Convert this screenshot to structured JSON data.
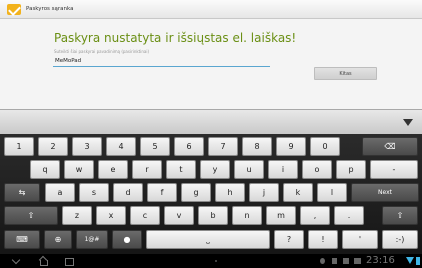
{
  "app": {
    "title": "Paskyros sąranka"
  },
  "main": {
    "headline": "Paskyra nustatyta ir išsiųstas el. laiškas!",
    "field_label": "Suteikti šiai paskyrai pavadinimą (pasirinktinai)",
    "name_value": "MeMoPad",
    "next_label": "Kitas"
  },
  "keyboard": {
    "rows": [
      {
        "keys": [
          "1",
          "2",
          "3",
          "4",
          "5",
          "6",
          "7",
          "8",
          "9",
          "0",
          "backspace-icon"
        ]
      },
      {
        "keys": [
          "q",
          "w",
          "e",
          "r",
          "t",
          "y",
          "u",
          "i",
          "o",
          "p",
          "-"
        ]
      },
      {
        "keys": [
          "tab-icon",
          "a",
          "s",
          "d",
          "f",
          "g",
          "h",
          "j",
          "k",
          "l",
          "Next"
        ]
      },
      {
        "keys": [
          "shift-icon",
          "z",
          "x",
          "c",
          "v",
          "b",
          "n",
          "m",
          ",",
          ".",
          "shift-icon"
        ]
      },
      {
        "keys": [
          "keyboard-icon",
          "globe-icon",
          "1@#",
          "mic-icon",
          "space-icon",
          "?",
          "!",
          "'",
          ":-)"
        ]
      }
    ]
  },
  "status": {
    "time": "23:16"
  },
  "colors": {
    "headline": "#6a8f14",
    "accent": "#3fb6e6"
  }
}
